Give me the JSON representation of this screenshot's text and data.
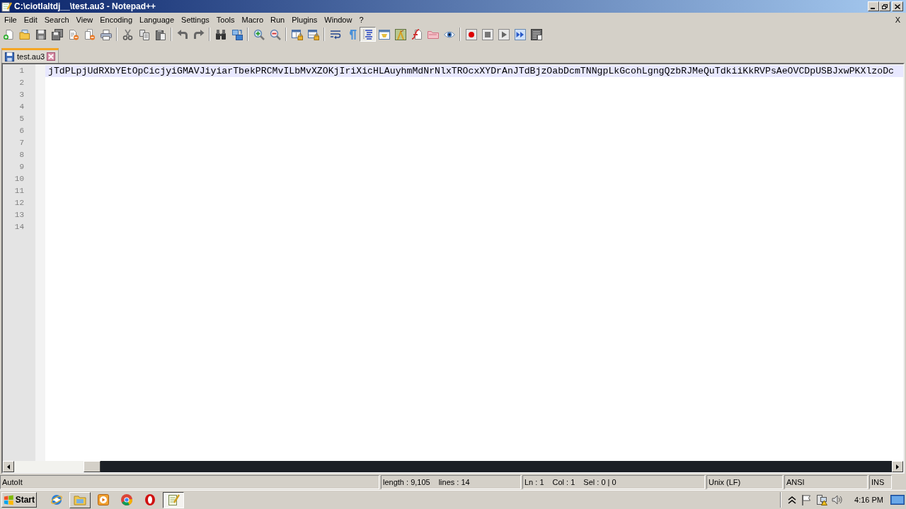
{
  "window": {
    "title": "C:\\ciotlaltdj__\\test.au3 - Notepad++",
    "controls": [
      {
        "kind": "minimize"
      },
      {
        "kind": "restore"
      },
      {
        "kind": "close"
      }
    ]
  },
  "menu": {
    "items": [
      "File",
      "Edit",
      "Search",
      "View",
      "Encoding",
      "Language",
      "Settings",
      "Tools",
      "Macro",
      "Run",
      "Plugins",
      "Window",
      "?"
    ],
    "close_label": "X"
  },
  "toolbar": [
    {
      "buttons": [
        {
          "kind": "new",
          "pressed": false
        },
        {
          "kind": "open",
          "pressed": false
        },
        {
          "kind": "save",
          "pressed": false
        },
        {
          "kind": "saveall",
          "pressed": false
        },
        {
          "kind": "close",
          "pressed": false
        },
        {
          "kind": "closeall",
          "pressed": false
        },
        {
          "kind": "print",
          "pressed": false
        }
      ]
    },
    {
      "buttons": [
        {
          "kind": "cut",
          "pressed": false
        },
        {
          "kind": "copy",
          "pressed": false
        },
        {
          "kind": "paste",
          "pressed": false
        }
      ]
    },
    {
      "buttons": [
        {
          "kind": "undo",
          "pressed": false
        },
        {
          "kind": "redo",
          "pressed": false
        }
      ]
    },
    {
      "buttons": [
        {
          "kind": "find",
          "pressed": false
        },
        {
          "kind": "replace",
          "pressed": false
        }
      ]
    },
    {
      "buttons": [
        {
          "kind": "zoomin",
          "pressed": false
        },
        {
          "kind": "zoomout",
          "pressed": false
        }
      ]
    },
    {
      "buttons": [
        {
          "kind": "vsync",
          "pressed": false
        },
        {
          "kind": "hsync",
          "pressed": false
        }
      ]
    },
    {
      "buttons": [
        {
          "kind": "wrap",
          "pressed": false
        },
        {
          "kind": "allchars",
          "pressed": false
        },
        {
          "kind": "indent",
          "pressed": true
        },
        {
          "kind": "udl",
          "pressed": false
        },
        {
          "kind": "docmap",
          "pressed": false
        },
        {
          "kind": "funclist",
          "pressed": false
        },
        {
          "kind": "workspace",
          "pressed": false
        },
        {
          "kind": "monitor",
          "pressed": false
        }
      ]
    },
    {
      "buttons": [
        {
          "kind": "record",
          "pressed": false
        },
        {
          "kind": "stop",
          "pressed": false
        },
        {
          "kind": "play",
          "pressed": false
        },
        {
          "kind": "playmulti",
          "pressed": false
        },
        {
          "kind": "savemacro",
          "pressed": false
        }
      ]
    }
  ],
  "tabs": [
    {
      "label": "test.au3",
      "selected": true,
      "modified": false
    }
  ],
  "editor": {
    "lines": [
      {
        "number": "1",
        "text": "jTdPLpjUdRXbYEtOpCicjyiGMAVJiyiarTbekPRCMvILbMvXZOKjIriXicHLAuyhmMdNrNlxTROcxXYDrAnJTdBjzOabDcmTNNgpLkGcohLgngQzbRJMeQuTdkiiKkRVPsAeOVCDpUSBJxwPKXlzoDc",
        "current": true
      },
      {
        "number": "2",
        "current": false
      },
      {
        "number": "3",
        "current": false
      },
      {
        "number": "4",
        "current": false
      },
      {
        "number": "5",
        "current": false
      },
      {
        "number": "6",
        "current": false
      },
      {
        "number": "7",
        "current": false
      },
      {
        "number": "8",
        "current": false
      },
      {
        "number": "9",
        "current": false
      },
      {
        "number": "10",
        "current": false
      },
      {
        "number": "11",
        "current": false
      },
      {
        "number": "12",
        "current": false
      },
      {
        "number": "13",
        "current": false
      },
      {
        "number": "14",
        "current": false
      }
    ]
  },
  "status_bar": [
    {
      "items": [
        "AutoIt"
      ]
    },
    {
      "items": [
        "length : 9,105",
        "lines : 14"
      ]
    },
    {
      "items": [
        "Ln : 1",
        "Col : 1",
        "Sel : 0 | 0"
      ]
    },
    {
      "items": [
        "Unix (LF)"
      ]
    },
    {
      "items": [
        "ANSI"
      ]
    },
    {
      "items": [
        "INS"
      ]
    }
  ],
  "taskbar": {
    "start": "Start",
    "apps": [
      {
        "kind": "ie",
        "running": false,
        "selected": false
      },
      {
        "kind": "explorer",
        "running": true,
        "selected": false
      },
      {
        "kind": "media",
        "running": false,
        "selected": false
      },
      {
        "kind": "chrome",
        "running": false,
        "selected": false
      },
      {
        "kind": "opera",
        "running": false,
        "selected": false
      },
      {
        "kind": "notepad",
        "running": true,
        "selected": true
      }
    ],
    "tray": [
      {
        "kind": "chevron"
      },
      {
        "kind": "flag"
      },
      {
        "kind": "network"
      },
      {
        "kind": "speaker"
      }
    ],
    "clock": "4:16 PM",
    "show_desktop": true
  }
}
